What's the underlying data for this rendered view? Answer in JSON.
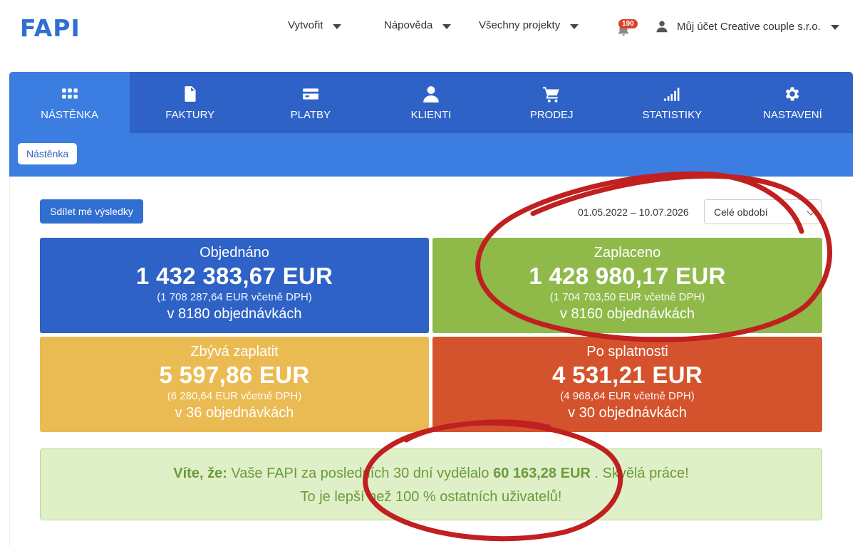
{
  "header": {
    "logo": "FAPI",
    "menu": [
      {
        "label": "Vytvořit"
      },
      {
        "label": "Nápověda"
      },
      {
        "label": "Všechny projekty"
      }
    ],
    "notifications_count": "190",
    "account_label": "Můj účet Creative couple s.r.o."
  },
  "nav": {
    "tabs": [
      {
        "label": "NÁSTĚNKA",
        "icon": "grid-icon"
      },
      {
        "label": "FAKTURY",
        "icon": "invoice-icon"
      },
      {
        "label": "PLATBY",
        "icon": "card-icon"
      },
      {
        "label": "KLIENTI",
        "icon": "person-icon"
      },
      {
        "label": "PRODEJ",
        "icon": "cart-icon"
      },
      {
        "label": "STATISTIKY",
        "icon": "signal-icon"
      },
      {
        "label": "NASTAVENÍ",
        "icon": "gear-icon"
      }
    ]
  },
  "breadcrumb": "Nástěnka",
  "toolbar": {
    "share_label": "Sdílet mé výsledky",
    "date_range": "01.05.2022 – 10.07.2026",
    "period_selected": "Celé období"
  },
  "cards": [
    {
      "title": "Objednáno",
      "amount": "1 432 383,67 EUR",
      "vat": "(1 708 287,64 EUR včetně DPH)",
      "count": "v 8180 objednávkách",
      "color": "#2e62c6"
    },
    {
      "title": "Zaplaceno",
      "amount": "1 428 980,17 EUR",
      "vat": "(1 704 703,50 EUR včetně DPH)",
      "count": "v 8160 objednávkách",
      "color": "#8fba4a"
    },
    {
      "title": "Zbývá zaplatit",
      "amount": "5 597,86 EUR",
      "vat": "(6 280,64 EUR včetně DPH)",
      "count": "v 36 objednávkách",
      "color": "#ebbb53"
    },
    {
      "title": "Po splatnosti",
      "amount": "4 531,21 EUR",
      "vat": "(4 968,64 EUR včetně DPH)",
      "count": "v 30 objednávkách",
      "color": "#d4532d"
    }
  ],
  "info": {
    "lead": "Víte, že:",
    "text1": "Vaše FAPI za posledních 30 dní vydělalo",
    "amount": "60 163,28 EUR",
    "text2": ". Skvělá práce!",
    "line2": "To je lepší než 100 % ostatních uživatelů!"
  },
  "colors": {
    "brand": "#2f6fd2",
    "annotation": "#c0201f"
  }
}
